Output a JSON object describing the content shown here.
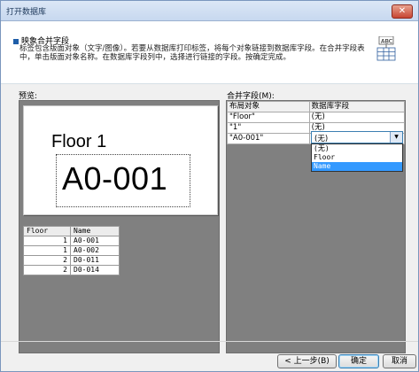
{
  "window": {
    "title": "打开数据库"
  },
  "header": {
    "section_title": "映象合并字段",
    "description": "标签包含版面对象（文字/图像）。若要从数据库打印标签，将每个对象链接到数据库字段。在合并字段表中，单击版面对象名称。在数据库字段列中，选择进行链接的字段。按确定完成。"
  },
  "preview": {
    "label": "预览:",
    "floor_text": "Floor 1",
    "code_text": "A0-001",
    "table": {
      "headers": [
        "Floor",
        "Name"
      ],
      "rows": [
        [
          "1",
          "A0-001"
        ],
        [
          "1",
          "A0-002"
        ],
        [
          "2",
          "D0-011"
        ],
        [
          "2",
          "D0-014"
        ]
      ]
    }
  },
  "merge_fields": {
    "label": "合并字段(M):",
    "headers": [
      "布局对象",
      "数据库字段"
    ],
    "rows": [
      {
        "object": "\"Floor\"",
        "field": "(无)"
      },
      {
        "object": "\"1\"",
        "field": "(无)"
      },
      {
        "object": "\"A0-001\"",
        "field": "(无)"
      }
    ],
    "dropdown": {
      "value": "(无)",
      "options": [
        "(无)",
        "Floor",
        "Name"
      ],
      "selected": "Name"
    }
  },
  "buttons": {
    "back": "< 上一步(B)",
    "ok": "确定",
    "cancel": "取消"
  }
}
